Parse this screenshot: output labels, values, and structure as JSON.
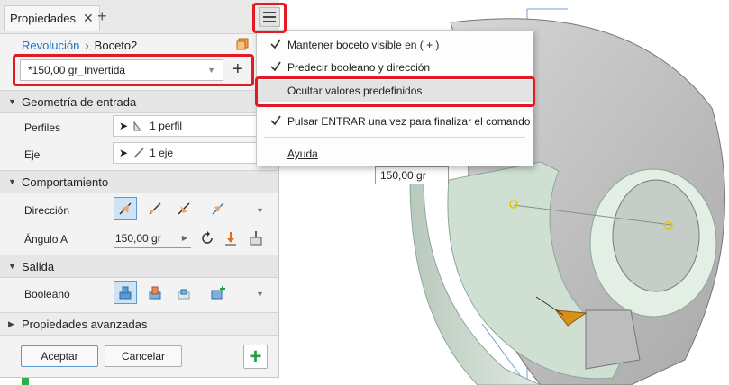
{
  "panel": {
    "tab_label": "Propiedades",
    "tab_close": "✕",
    "tab_add": "+",
    "breadcrumb": {
      "root": "Revolución",
      "separator": "›",
      "current": "Boceto2"
    },
    "preset": {
      "value": "*150,00 gr_Invertida",
      "add": "+"
    },
    "sections": {
      "input": "Geometría de entrada",
      "behavior": "Comportamiento",
      "output": "Salida",
      "advanced": "Propiedades avanzadas"
    },
    "input": {
      "profiles_label": "Perfiles",
      "profiles_value": "1 perfil",
      "axis_label": "Eje",
      "axis_value": "1 eje"
    },
    "behavior": {
      "direction_label": "Dirección",
      "angle_label": "Ángulo A",
      "angle_value": "150,00 gr"
    },
    "output": {
      "boolean_label": "Booleano"
    },
    "buttons": {
      "ok": "Aceptar",
      "cancel": "Cancelar",
      "plus": "+"
    }
  },
  "menu": {
    "items": [
      {
        "label": "Mantener boceto visible en ( + )",
        "checked": true
      },
      {
        "label": "Predecir booleano y dirección",
        "checked": true
      },
      {
        "label": "Ocultar valores predefinidos",
        "checked": false
      },
      {
        "label": "Pulsar ENTRAR una vez para finalizar el comando",
        "checked": true
      },
      {
        "label": "Ayuda",
        "checked": false
      }
    ]
  },
  "viewport": {
    "dimension_value": "150,00 gr"
  },
  "colors": {
    "accent": "#1a73c9",
    "highlight": "#e01b24",
    "add_green": "#22a046",
    "active_btn": "#cfe3f5"
  }
}
